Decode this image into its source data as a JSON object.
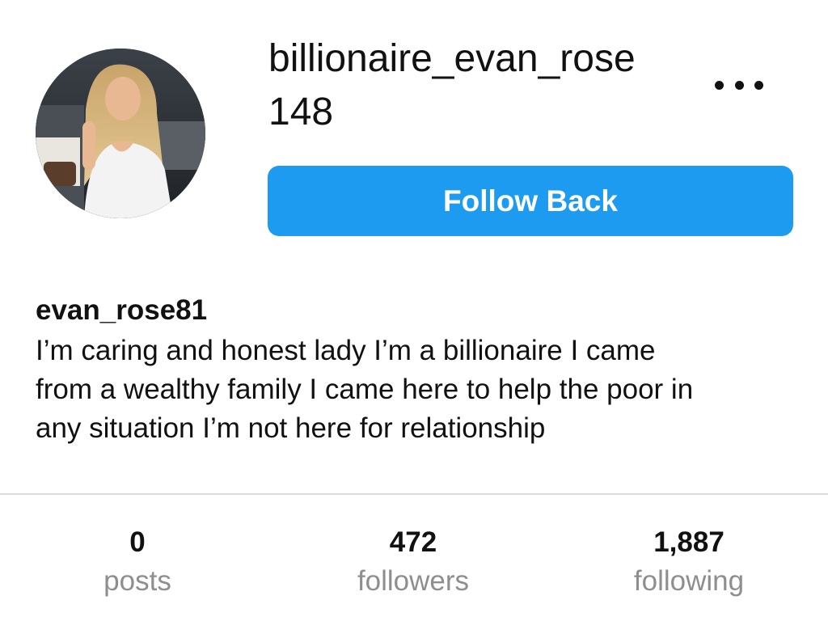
{
  "profile": {
    "username": "billionaire_evan_rose",
    "count_under_name": "148",
    "follow_button_label": "Follow Back",
    "display_name": "evan_rose81",
    "bio_lines": [
      "I’m caring and honest lady I’m a billionaire I came",
      "from a wealthy family I came here to help the poor in",
      "any situation I’m not here for relationship"
    ]
  },
  "stats": [
    {
      "value": "0",
      "label": "posts"
    },
    {
      "value": "472",
      "label": "followers"
    },
    {
      "value": "1,887",
      "label": "following"
    }
  ],
  "icons": {
    "more": "more-options-icon"
  },
  "colors": {
    "accent": "#1d9bf0",
    "text": "#111111",
    "muted": "#8e8e8e",
    "divider": "#dcdcdc"
  }
}
